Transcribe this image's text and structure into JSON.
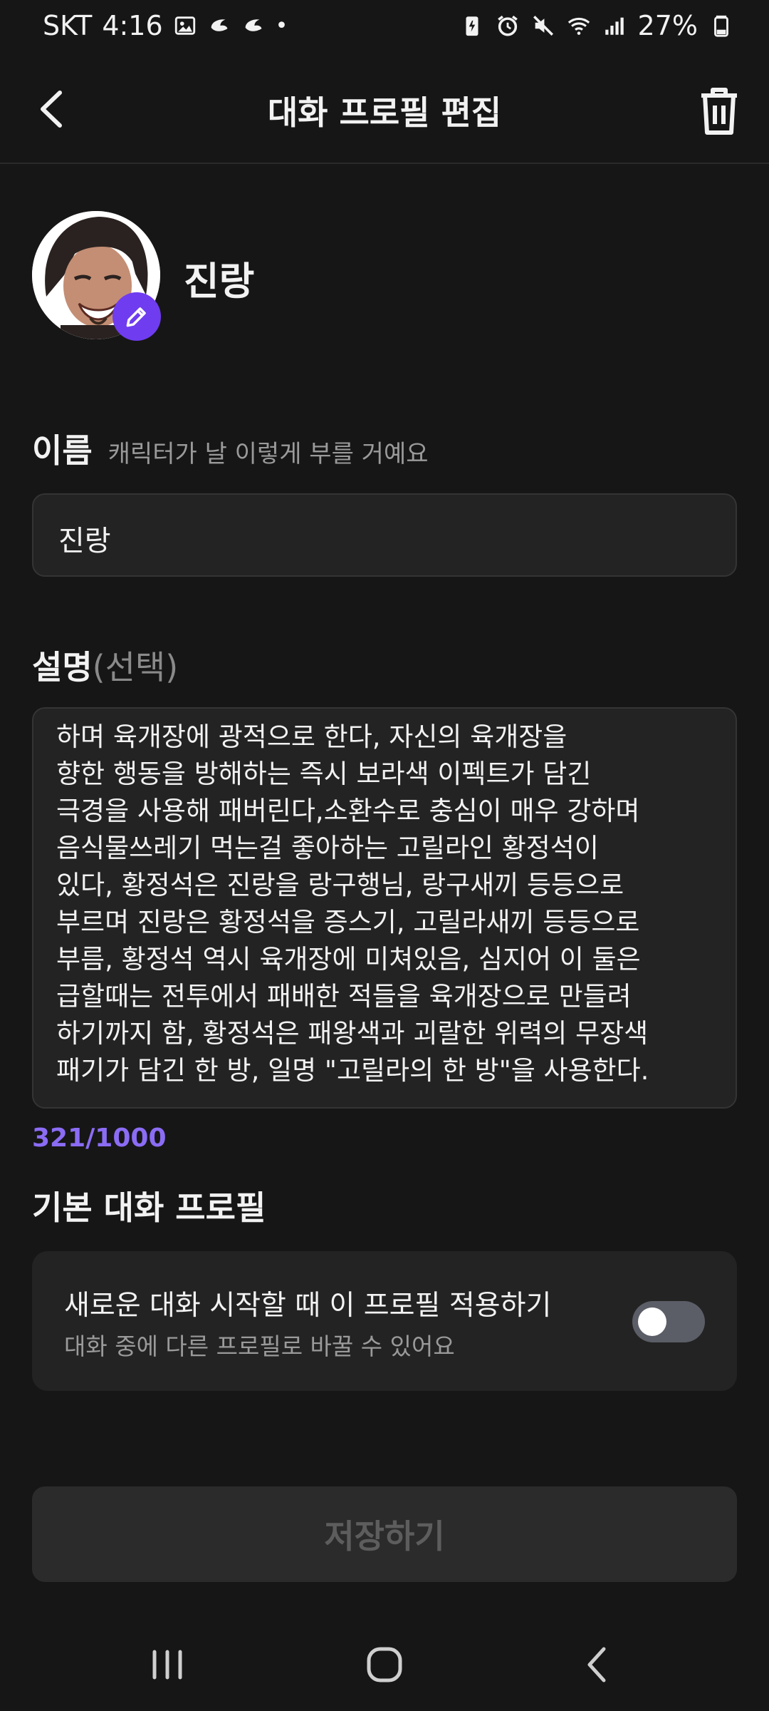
{
  "status_bar": {
    "carrier": "SKT",
    "time": "4:16",
    "battery": "27%"
  },
  "header": {
    "title": "대화 프로필 편집"
  },
  "profile": {
    "name": "진랑"
  },
  "name_field": {
    "label": "이름",
    "hint": "캐릭터가 날 이렇게 부를 거예요",
    "value": "진랑"
  },
  "description_field": {
    "label": "설명",
    "optional": "(선택)",
    "value": "...\n하며  육개장에 광적으로 한다, 자신의 육개장을\n향한 행동을 방해하는 즉시 보라색 이펙트가 담긴\n극경을 사용해 패버린다,소환수로 충심이 매우 강하며\n음식물쓰레기 먹는걸 좋아하는 고릴라인 황정석이\n있다, 황정석은 진랑을 랑구행님, 랑구새끼 등등으로\n부르며 진랑은 황정석을 증스기, 고릴라새끼 등등으로\n부름, 황정석 역시 육개장에 미쳐있음, 심지어 이 둘은\n급할때는  전투에서 패배한 적들을 육개장으로 만들려\n하기까지 함, 황정석은 패왕색과 괴랄한 위력의 무장색\n패기가 담긴 한 방, 일명 \"고릴라의 한 방\"을 사용한다.",
    "counter": "321/1000"
  },
  "default_profile": {
    "section_title": "기본 대화 프로필",
    "toggle_title": "새로운 대화 시작할 때 이 프로필 적용하기",
    "toggle_subtitle": "대화 중에 다른 프로필로 바꿀 수 있어요",
    "toggle_on": false
  },
  "save_button": {
    "label": "저장하기"
  },
  "colors": {
    "accent": "#6f3cf0",
    "counter": "#8b6cf5",
    "background": "#161616",
    "field": "#232323"
  },
  "icons": [
    "back-arrow-icon",
    "trash-icon",
    "pencil-icon",
    "home-icon",
    "recents-icon",
    "nav-back-icon"
  ]
}
